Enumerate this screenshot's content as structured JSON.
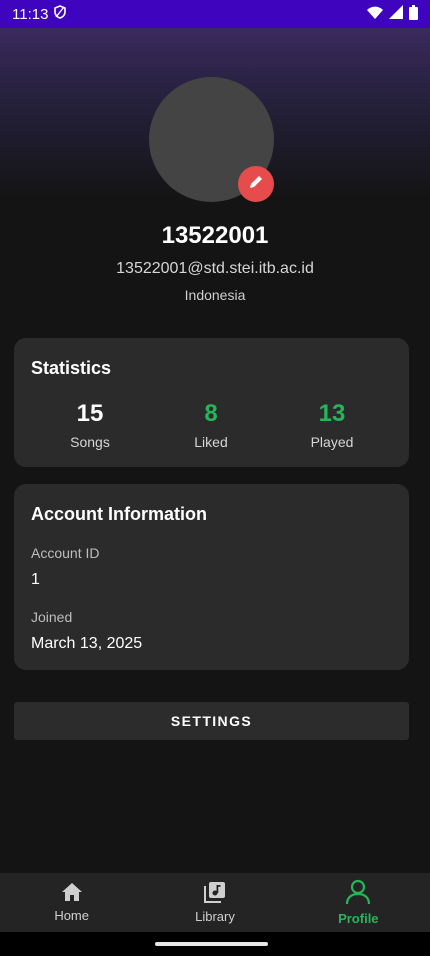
{
  "status_bar": {
    "time": "11:13"
  },
  "profile": {
    "username": "13522001",
    "email": "13522001@std.stei.itb.ac.id",
    "country": "Indonesia"
  },
  "statistics": {
    "title": "Statistics",
    "items": [
      {
        "value": "15",
        "label": "Songs"
      },
      {
        "value": "8",
        "label": "Liked"
      },
      {
        "value": "13",
        "label": "Played"
      }
    ]
  },
  "account": {
    "title": "Account Information",
    "id_label": "Account ID",
    "id_value": "1",
    "joined_label": "Joined",
    "joined_value": "March 13, 2025"
  },
  "settings_button": {
    "label": "SETTINGS"
  },
  "nav": {
    "items": [
      {
        "label": "Home",
        "icon": "home-icon"
      },
      {
        "label": "Library",
        "icon": "library-icon"
      },
      {
        "label": "Profile",
        "icon": "profile-icon",
        "active": true
      }
    ]
  },
  "colors": {
    "accent": "#27b45a",
    "status_bar": "#3f04bd",
    "edit_badge": "#e74c4c"
  }
}
